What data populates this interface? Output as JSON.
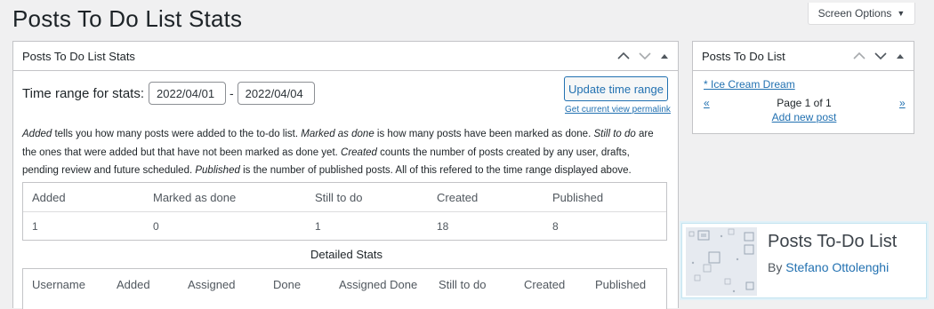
{
  "page": {
    "title": "Posts To Do List Stats"
  },
  "screen_options": {
    "label": "Screen Options"
  },
  "stats_box": {
    "title": "Posts To Do List Stats",
    "range_label": "Time range for stats:",
    "from_value": "2022/04/01",
    "separator": "-",
    "to_value": "2022/04/04",
    "update_button": "Update time range",
    "permalink": "Get current view permalink",
    "description": {
      "p1": "Added",
      "p2": " tells you how many posts were added to the to-do list. ",
      "p3": "Marked as done",
      "p4": " is how many posts have been marked as done. ",
      "p5": "Still to do",
      "p6": " are the ones that were added but that have not been marked as done yet. ",
      "p7": "Created",
      "p8": " counts the number of posts created by any user, drafts, pending review and future scheduled. ",
      "p9": "Published",
      "p10": " is the number of published posts. All of this refered to the time range displayed above."
    },
    "summary_table": {
      "headers": [
        "Added",
        "Marked as done",
        "Still to do",
        "Created",
        "Published"
      ],
      "values": [
        "1",
        "0",
        "1",
        "18",
        "8"
      ]
    },
    "detailed_label": "Detailed Stats",
    "detailed_table": {
      "headers": [
        "Username",
        "Added",
        "Assigned",
        "Done",
        "Assigned Done",
        "Still to do",
        "Created",
        "Published"
      ]
    }
  },
  "todo_box": {
    "title": "Posts To Do List",
    "item": "* Ice Cream Dream",
    "prev": "«",
    "page": "Page 1 of 1",
    "next": "»",
    "add_new": "Add new post"
  },
  "plugin_card": {
    "name": "Posts To-Do List",
    "by": "By ",
    "author": "Stefano Ottolenghi"
  },
  "colors": {
    "link": "#2271b1",
    "border": "#c3c4c7",
    "background": "#f0f0f1"
  }
}
